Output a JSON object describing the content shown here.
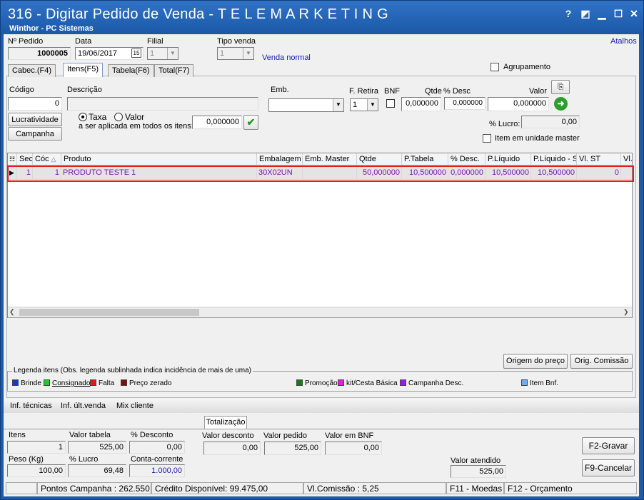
{
  "window": {
    "title": "316 - Digitar Pedido de Venda - T E L E M A R K E T I N G",
    "subtitle": "Winthor - PC Sistemas",
    "help": "?"
  },
  "header": {
    "pedido_label": "Nº Pedido",
    "pedido": "1000005",
    "data_label": "Data",
    "data": "19/06/2017",
    "filial_label": "Filial",
    "filial": "1",
    "tipo_label": "Tipo venda",
    "tipo": "1",
    "tipo_desc": "Venda normal",
    "atalhos": "Atalhos",
    "agrupamento": "Agrupamento"
  },
  "tabs": [
    "Cabec.(F4)",
    "Itens(F5)",
    "Tabela(F6)",
    "Total(F7)"
  ],
  "item_entry": {
    "codigo_label": "Código",
    "codigo": "0",
    "descricao_label": "Descrição",
    "emb_label": "Emb.",
    "fretira_label": "F. Retira",
    "fretira": "1",
    "bnf_label": "BNF",
    "qtde_label": "Qtde",
    "qtde": "0,000000",
    "desc_label": "% Desc",
    "desc": "0,000000",
    "valor_label": "Valor",
    "valor": "0,000000",
    "lucratividade": "Lucratividade",
    "campanha": "Campanha",
    "taxa": "Taxa",
    "valor_radio": "Valor",
    "aplicada_label": "a ser aplicada em todos os itens:",
    "aplicada": "0,000000",
    "lucro_label": "% Lucro:",
    "lucro": "0,00",
    "master_label": "Item em unidade master"
  },
  "grid": {
    "columns": [
      "Sec",
      "Cóc",
      "Produto",
      "Embalagem",
      "Emb. Master",
      "Qtde",
      "P.Tabela",
      "% Desc.",
      "P.Líquido",
      "P.Líquido - S",
      "Vl. ST",
      "Vl."
    ],
    "rows": [
      {
        "sec": "1",
        "cod": "1",
        "produto": "PRODUTO TESTE 1",
        "embalagem": "30X02UN",
        "master": "",
        "qtde": "50,000000",
        "ptabela": "10,500000",
        "desc": "0,000000",
        "pliq": "10,500000",
        "pliqs": "10,500000",
        "vlst": "0"
      }
    ]
  },
  "buttons": {
    "origem": "Origem do preço",
    "comissao": "Orig. Comissão",
    "gravar": "F2-Gravar",
    "cancelar": "F9-Cancelar"
  },
  "legend": {
    "title": "Legenda itens (Obs. legenda sublinhada indica incidência de mais de uma)",
    "items": [
      {
        "label": "Brinde",
        "color": "#1438d8"
      },
      {
        "label": "Consignado",
        "color": "#22cc22"
      },
      {
        "label": "Falta",
        "color": "#e81818"
      },
      {
        "label": "Preço zerado",
        "color": "#7a1010"
      },
      {
        "label": "Promoção",
        "color": "#1a7a1a"
      },
      {
        "label": "kit/Cesta Básica",
        "color": "#e818e8"
      },
      {
        "label": "Campanha Desc.",
        "color": "#9a18e8"
      },
      {
        "label": "Item Bnf.",
        "color": "#6ab0f0"
      }
    ]
  },
  "links": [
    "Inf. técnicas",
    "Inf. últ.venda",
    "Mix cliente"
  ],
  "totals": {
    "tab": "Totalização",
    "itens_label": "Itens",
    "itens": "1",
    "valor_tabela_label": "Valor tabela",
    "valor_tabela": "525,00",
    "pdesc_label": "% Desconto",
    "pdesc": "0,00",
    "valor_desconto_label": "Valor desconto",
    "valor_desconto": "0,00",
    "valor_pedido_label": "Valor pedido",
    "valor_pedido": "525,00",
    "valor_bnf_label": "Valor em BNF",
    "valor_bnf": "0,00",
    "peso_label": "Peso (Kg)",
    "peso": "100,00",
    "lucro_label": "% Lucro",
    "lucro": "69,48",
    "cc_label": "Conta-corrente",
    "cc": "1.000,00",
    "atendido_label": "Valor atendido",
    "atendido": "525,00"
  },
  "status": {
    "pontos": "Pontos Campanha : 262.550,0",
    "credito": "Crédito Disponível: 99.475,00",
    "comissao": "Vl.Comissão : 5,25",
    "moedas": "F11 - Moedas",
    "orcamento": "F12 - Orçamento"
  }
}
